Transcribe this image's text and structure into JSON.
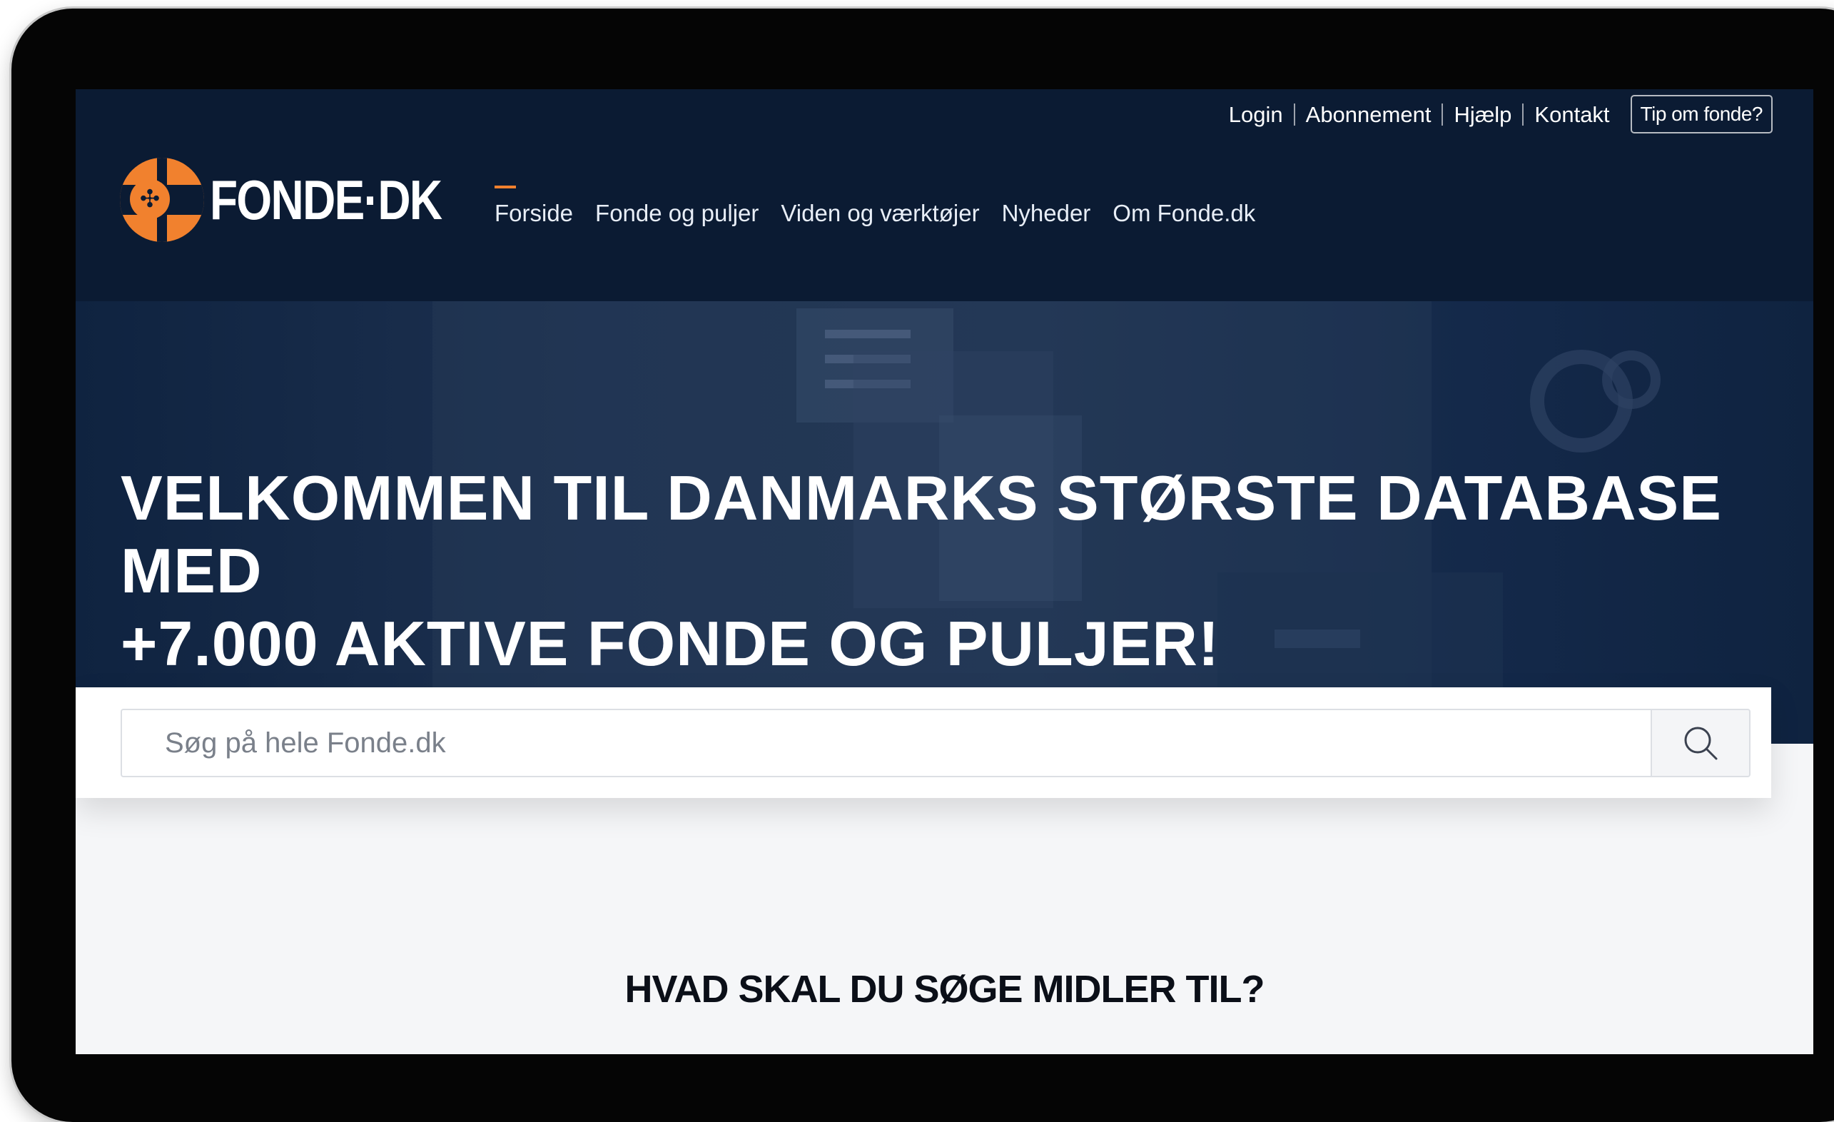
{
  "header": {
    "top_links": [
      "Login",
      "Abonnement",
      "Hjælp",
      "Kontakt"
    ],
    "tip_button_label": "Tip om fonde?",
    "logo_text": "FONDE·DK",
    "nav": [
      {
        "label": "Forside",
        "active": true
      },
      {
        "label": "Fonde og puljer",
        "active": false
      },
      {
        "label": "Viden og værktøjer",
        "active": false
      },
      {
        "label": "Nyheder",
        "active": false
      },
      {
        "label": "Om Fonde.dk",
        "active": false
      }
    ]
  },
  "hero": {
    "title_line1": "VELKOMMEN TIL DANMARKS STØRSTE DATABASE MED",
    "title_line2": "+7.000 AKTIVE FONDE OG PULJER!"
  },
  "search": {
    "placeholder": "Søg på hele Fonde.dk",
    "button_icon": "search-icon"
  },
  "section": {
    "title": "HVAD SKAL DU SØGE MIDLER TIL?"
  },
  "colors": {
    "navy": "#0b1b33",
    "accent_orange": "#f1812e",
    "page_background": "#f5f6f8"
  }
}
